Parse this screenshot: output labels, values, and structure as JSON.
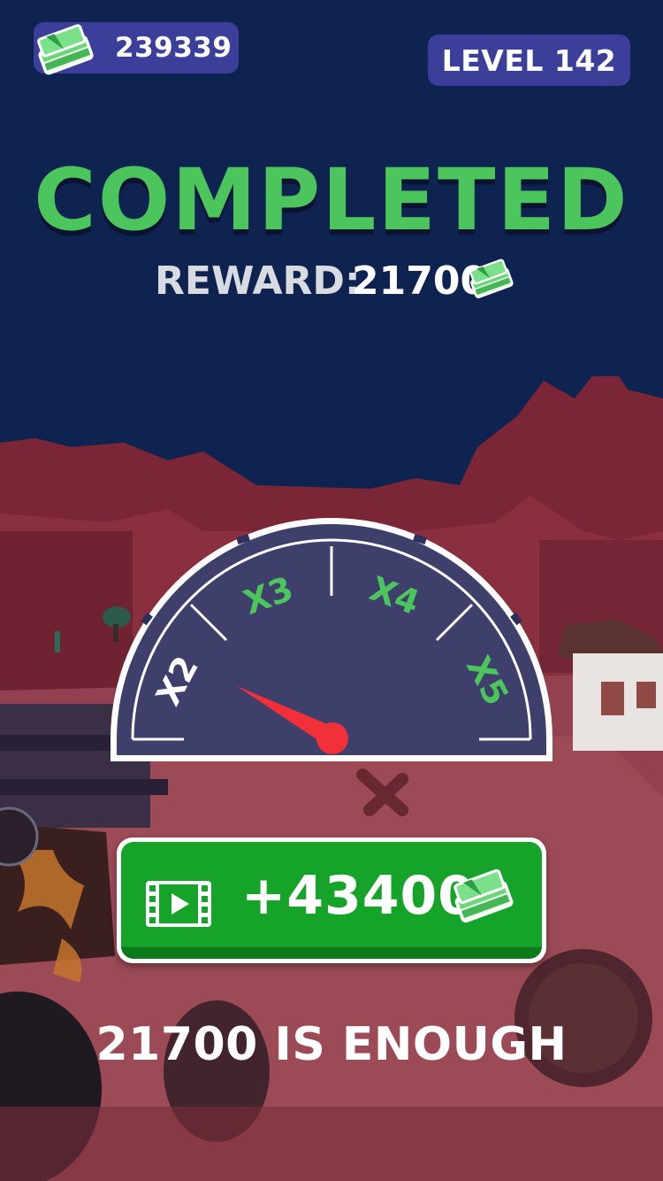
{
  "hud": {
    "currency_value": "239339",
    "level_label": "LEVEL 142"
  },
  "result": {
    "title": "COMPLETED",
    "reward_label": "REWARD:",
    "reward_value": "21700"
  },
  "multiplier_gauge": {
    "labels": [
      "X2",
      "X3",
      "X4",
      "X5"
    ],
    "needle_position": "X2"
  },
  "multiply_button": {
    "amount": "+43400",
    "icon": "video-icon"
  },
  "skip_link": {
    "label": "21700 IS ENOUGH"
  },
  "colors": {
    "sky": "#0f2350",
    "title_green": "#4cc65c",
    "pill": "#3b3f9a",
    "button_green": "#16a32a",
    "needle_red": "#f2303a",
    "gauge_fill": "#2e2f5e"
  }
}
